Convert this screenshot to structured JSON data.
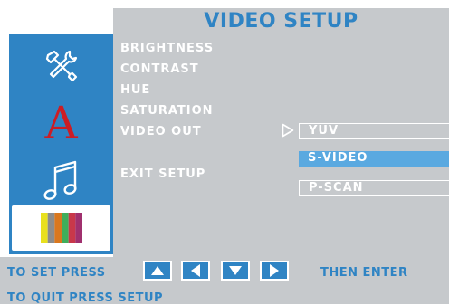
{
  "header": {
    "title": "VIDEO SETUP"
  },
  "sidebar": {
    "icons": [
      {
        "name": "tools-icon",
        "selected": false
      },
      {
        "name": "language-icon",
        "glyph": "A",
        "selected": false
      },
      {
        "name": "audio-note-icon",
        "selected": false
      },
      {
        "name": "video-color-bars-icon",
        "selected": true
      }
    ]
  },
  "menu": {
    "items": [
      "BRIGHTNESS",
      "CONTRAST",
      "HUE",
      "SATURATION",
      "VIDEO OUT",
      "EXIT SETUP"
    ]
  },
  "video_out": {
    "options": [
      {
        "label": "YUV",
        "state": "current"
      },
      {
        "label": "S-VIDEO",
        "state": "highlighted"
      },
      {
        "label": "P-SCAN",
        "state": "normal"
      }
    ]
  },
  "footer": {
    "set_press": "TO SET PRESS",
    "then_enter": "THEN ENTER",
    "quit": "TO QUIT PRESS SETUP",
    "nav_keys": [
      "up-arrow-icon",
      "left-arrow-icon",
      "down-arrow-icon",
      "right-arrow-icon"
    ]
  },
  "colors": {
    "panel_gray": "#c6c9cc",
    "accent_blue": "#2f84c4",
    "highlight_blue": "#5aa9e0",
    "color_bars": [
      "#e8e01e",
      "#8c8c8c",
      "#d9771e",
      "#3fae5a",
      "#c8384a",
      "#a0306e"
    ]
  }
}
